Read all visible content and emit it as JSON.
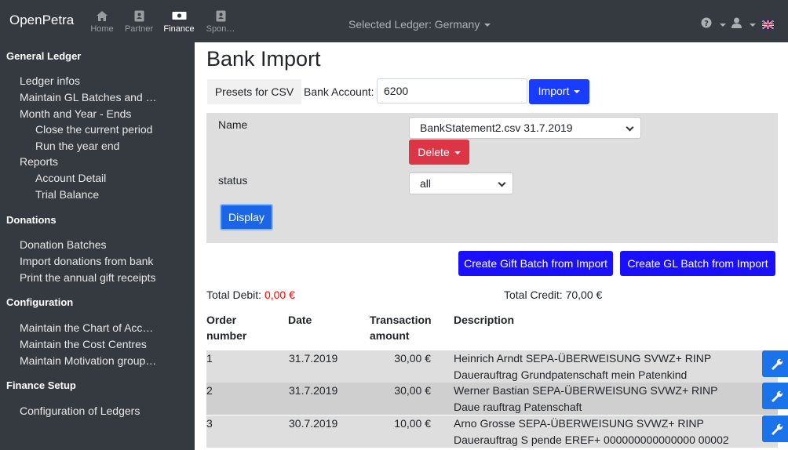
{
  "navbar": {
    "brand": "OpenPetra",
    "items": [
      {
        "label": "Home",
        "icon": "home-icon"
      },
      {
        "label": "Partner",
        "icon": "address-card-icon"
      },
      {
        "label": "Finance",
        "icon": "money-bill-icon"
      },
      {
        "label": "Spon…",
        "icon": "address-book-icon"
      }
    ],
    "ledger": "Selected Ledger: Germany",
    "help_icon": "question-circle-icon",
    "user_icon": "user-icon",
    "flag_icon": "uk-flag-icon"
  },
  "sidebar": {
    "sections": [
      {
        "title": "General Ledger",
        "items": [
          {
            "label": "Ledger infos"
          },
          {
            "label": "Maintain GL Batches and …"
          },
          {
            "label": "Month and Year - Ends"
          },
          {
            "label": "Close the current period"
          },
          {
            "label": "Run the year end"
          },
          {
            "label": "Reports"
          },
          {
            "label": "Account Detail"
          },
          {
            "label": "Trial Balance"
          }
        ]
      },
      {
        "title": "Donations",
        "items": [
          {
            "label": "Donation Batches"
          },
          {
            "label": "Import donations from bank"
          },
          {
            "label": "Print the annual gift receipts"
          }
        ]
      },
      {
        "title": "Configuration",
        "items": [
          {
            "label": "Maintain the Chart of Acc…"
          },
          {
            "label": "Maintain the Cost Centres"
          },
          {
            "label": "Maintain Motivation group…"
          }
        ]
      },
      {
        "title": "Finance Setup",
        "items": [
          {
            "label": "Configuration of Ledgers"
          }
        ]
      }
    ]
  },
  "main": {
    "title": "Bank Import",
    "presets_label": "Presets for CSV",
    "bank_account_label": "Bank Account:",
    "bank_account_value": "6200",
    "import_label": "Import",
    "filter": {
      "name_label": "Name",
      "name_selected": "BankStatement2.csv 31.7.2019",
      "delete_label": "Delete",
      "status_label": "status",
      "status_selected": "all",
      "display_label": "Display"
    },
    "create_gift_label": "Create Gift Batch from Import",
    "create_gl_label": "Create GL Batch from Import",
    "total_debit_label": "Total Debit:",
    "total_debit_value": "0,00 €",
    "total_credit_label": "Total Credit:",
    "total_credit_value": "70,00 €",
    "table": {
      "headers": {
        "order_1": "Order",
        "order_2": "number",
        "date": "Date",
        "amount_1": "Transaction",
        "amount_2": "amount",
        "description": "Description"
      },
      "rows": [
        {
          "order": "1",
          "date": "31.7.2019",
          "amount": "30,00 €",
          "desc_1": "Heinrich Arndt SEPA-ÜBERWEISUNG SVWZ+ RINP",
          "desc_2": "Dauerauftrag Grundpatenschaft mein Patenkind"
        },
        {
          "order": "2",
          "date": "31.7.2019",
          "amount": "30,00 €",
          "desc_1": "Werner Bastian SEPA-ÜBERWEISUNG SVWZ+ RINP",
          "desc_2": "Daue rauftrag Patenschaft"
        },
        {
          "order": "3",
          "date": "30.7.2019",
          "amount": "10,00 €",
          "desc_1": "Arno Grosse SEPA-ÜBERWEISUNG SVWZ+ RINP",
          "desc_2": "Dauerauftrag S pende EREF+ 000000000000000 00002"
        }
      ],
      "row_button_icon": "wrench-icon"
    }
  },
  "colors": {
    "navbar_bg": "#343a40",
    "primary": "#1a3cff",
    "danger": "#dc3545",
    "debit_red": "#ff0000"
  }
}
